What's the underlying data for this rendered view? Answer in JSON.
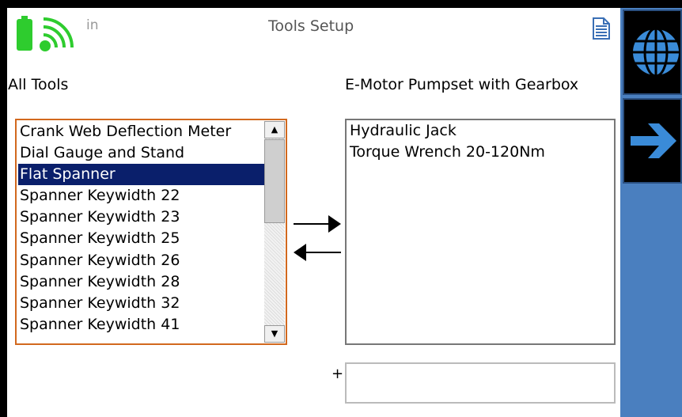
{
  "header": {
    "title": "Tools Setup",
    "unit_label": "in",
    "icons": [
      "battery-icon",
      "wifi-icon",
      "document-icon"
    ]
  },
  "left_panel": {
    "label": "All Tools",
    "items": [
      "Crank Web Deflection Meter",
      "Dial Gauge and Stand",
      "Flat Spanner",
      "Spanner Keywidth 22",
      "Spanner Keywidth 23",
      "Spanner Keywidth 25",
      "Spanner Keywidth 26",
      "Spanner Keywidth 28",
      "Spanner Keywidth 32",
      "Spanner Keywidth 41"
    ],
    "selected": "Flat Spanner"
  },
  "right_panel": {
    "label": "E-Motor Pumpset with Gearbox",
    "items": [
      "Hydraulic Jack",
      "Torque Wrench 20-120Nm"
    ]
  },
  "add_field": {
    "prefix": "+",
    "value": ""
  },
  "sidebar": {
    "buttons": [
      "globe-icon",
      "arrow-right-icon"
    ]
  },
  "colors": {
    "accent": "#4a7fbf",
    "selection": "#0a1f6b",
    "list_border": "#d2691e",
    "battery": "#2ecc2e"
  }
}
